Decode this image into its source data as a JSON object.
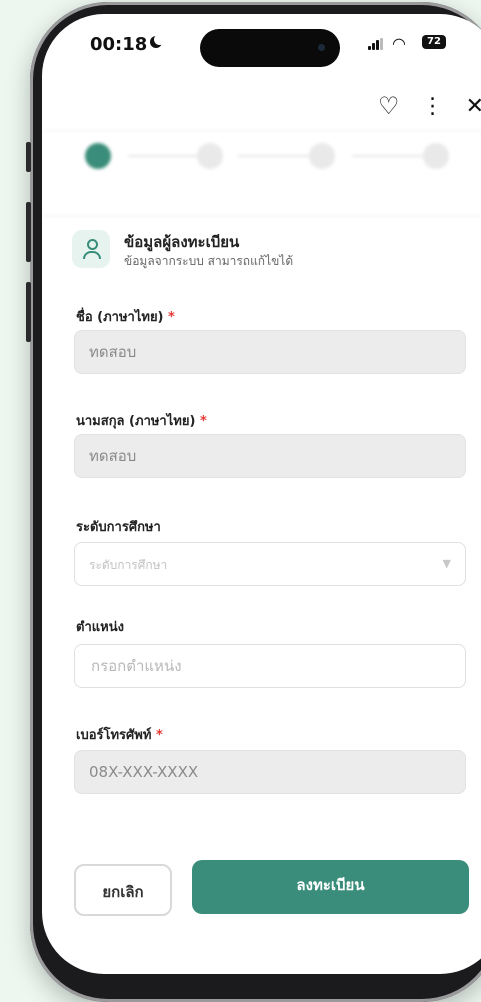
{
  "status_bar": {
    "time": "00:18",
    "battery": "72"
  },
  "header": {
    "favorite_icon": "heart-icon",
    "more_icon": "more-vertical-icon",
    "close_icon": "close-icon"
  },
  "section": {
    "title": "ข้อมูลผู้ลงทะเบียน",
    "subtitle": "ข้อมูลจากระบบ สามารถแก้ไขได้"
  },
  "form": {
    "first_name": {
      "label": "ชื่อ (ภาษาไทย)",
      "value": "ทดสอบ",
      "required": true
    },
    "last_name": {
      "label": "นามสกุล (ภาษาไทย)",
      "value": "ทดสอบ",
      "required": true
    },
    "education": {
      "label": "ระดับการศึกษา",
      "placeholder": "ระดับการศึกษา"
    },
    "position": {
      "label": "ตำแหน่ง",
      "placeholder": "กรอกตำแหน่ง"
    },
    "phone": {
      "label": "เบอร์โทรศัพท์",
      "value": "08X-XXX-XXXX",
      "required": true
    }
  },
  "actions": {
    "cancel": "ยกเลิก",
    "submit": "ลงทะเบียน"
  },
  "colors": {
    "primary": "#3a8d7a",
    "required": "#e53935",
    "background": "#edf7f0"
  }
}
